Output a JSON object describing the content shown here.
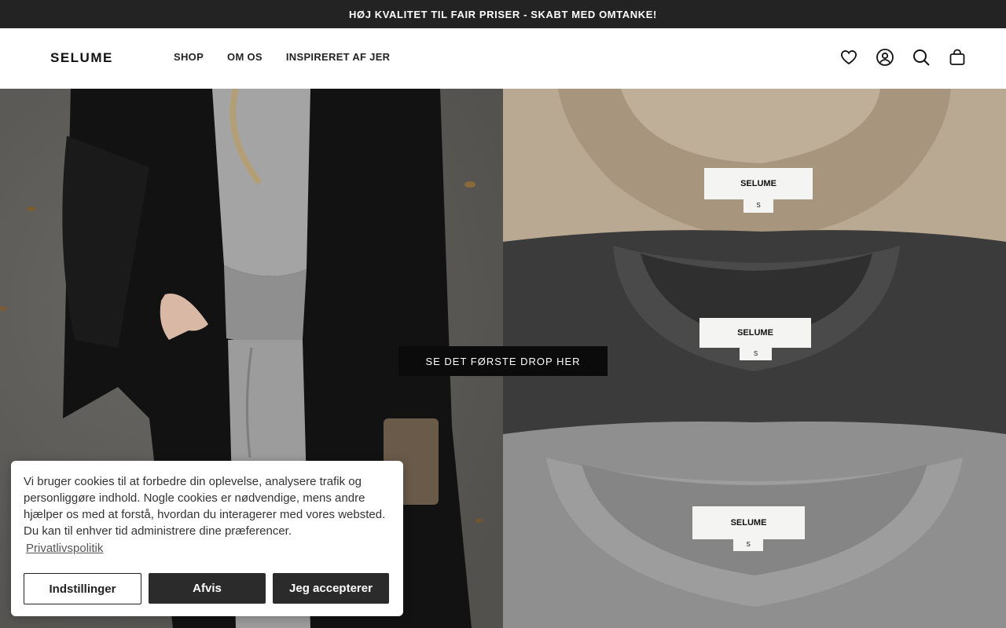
{
  "announcement": "HØJ KVALITET TIL FAIR PRISER - SKABT MED OMTANKE!",
  "header": {
    "logo": "SELUME",
    "nav": [
      "SHOP",
      "OM OS",
      "INSPIRERET AF JER"
    ],
    "icons": [
      "heart-icon",
      "account-icon",
      "search-icon",
      "cart-icon"
    ]
  },
  "hero": {
    "cta_label": "SE DET FØRSTE DROP HER",
    "labels": [
      {
        "brand": "SELUME",
        "size": "S"
      },
      {
        "brand": "SELUME",
        "size": "S"
      },
      {
        "brand": "SELUME",
        "size": "S"
      }
    ]
  },
  "cookie": {
    "text": "Vi bruger cookies til at forbedre din oplevelse, analysere trafik og personliggøre indhold. Nogle cookies er nødvendige, mens andre hjælper os med at forstå, hvordan du interagerer med vores websted. Du kan til enhver tid administrere dine præferencer.",
    "link": "Privatlivspolitik",
    "buttons": {
      "settings": "Indstillinger",
      "decline": "Afvis",
      "accept": "Jeg accepterer"
    }
  },
  "colors": {
    "announcement_bg": "#232323",
    "button_dark": "#2b2b2b",
    "cta_bg": "#0b0b0b"
  }
}
